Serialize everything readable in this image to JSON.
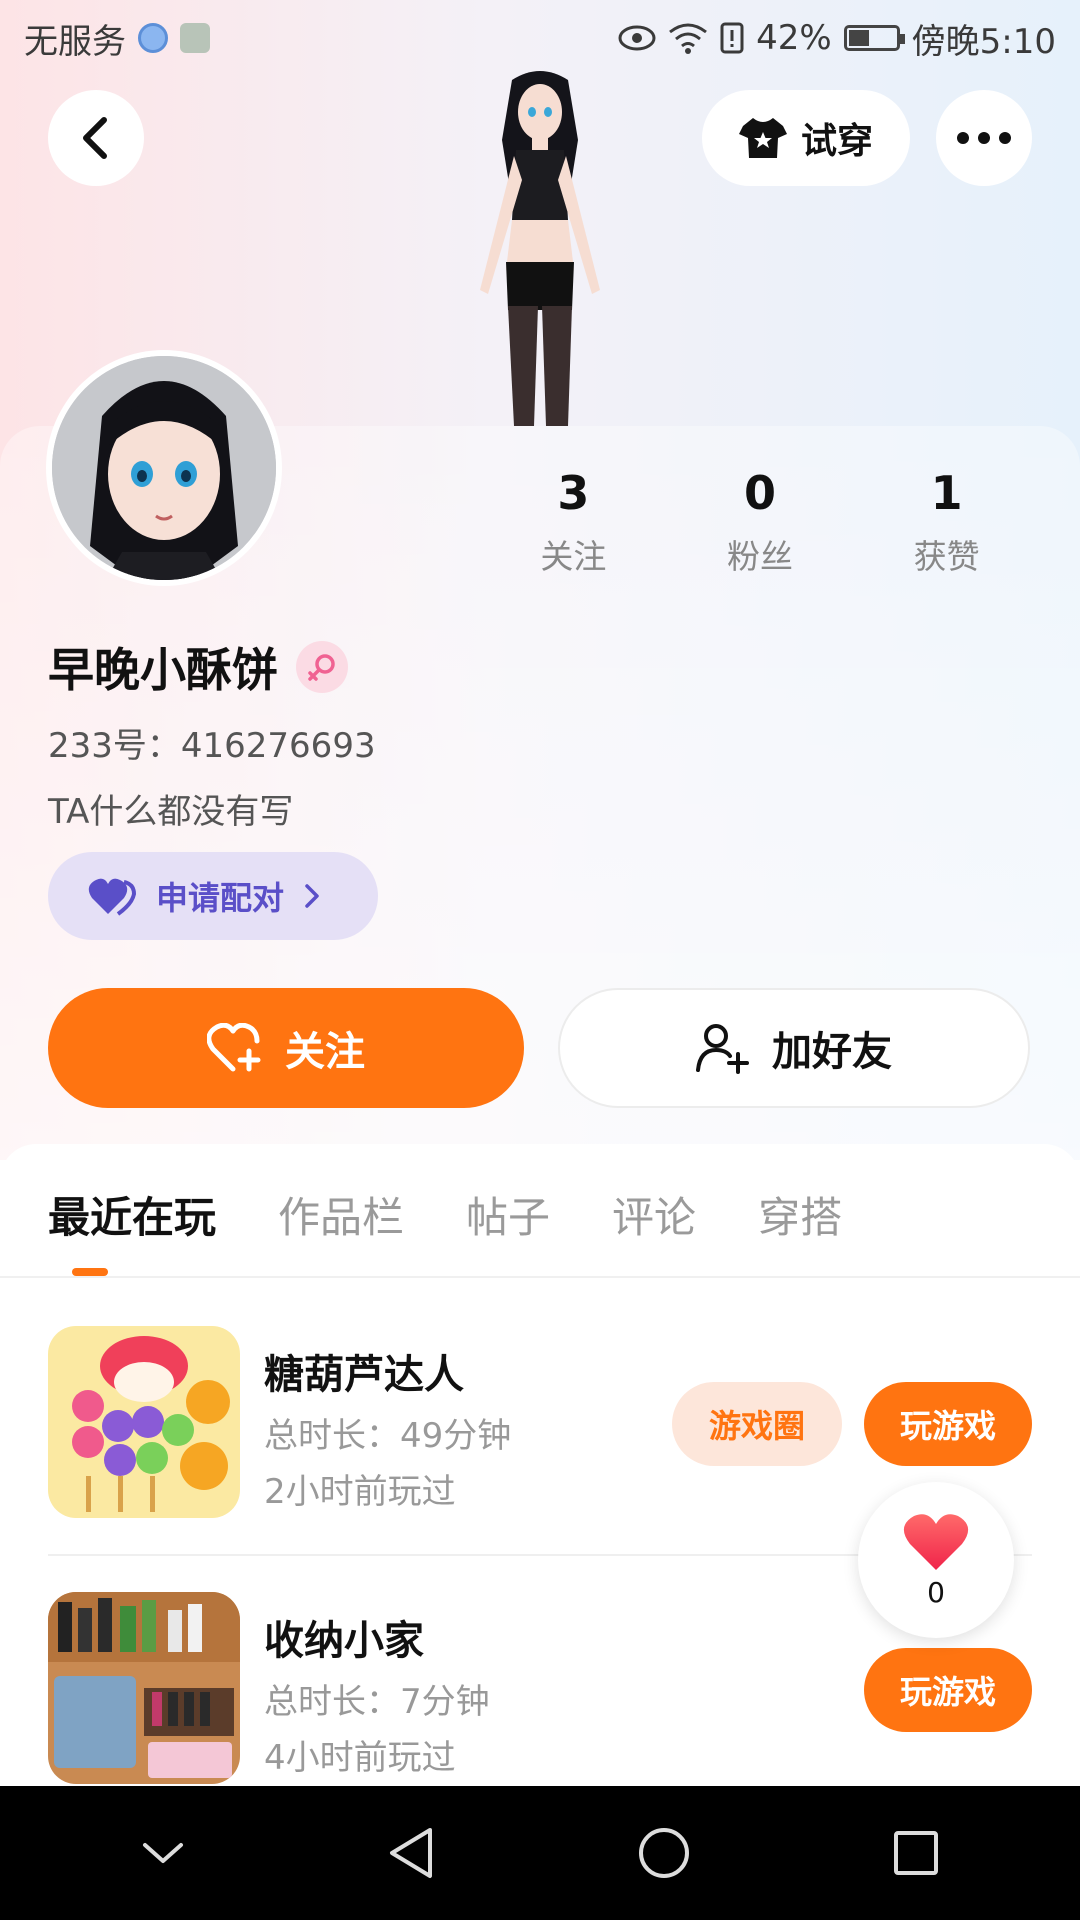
{
  "status_bar": {
    "carrier": "无服务",
    "battery_percent": "42%",
    "time": "傍晚5:10"
  },
  "header": {
    "tryon_label": "试穿"
  },
  "profile": {
    "stats": [
      {
        "value": "3",
        "label": "关注"
      },
      {
        "value": "0",
        "label": "粉丝"
      },
      {
        "value": "1",
        "label": "获赞"
      }
    ],
    "username": "早晚小酥饼",
    "id_text": "233号：416276693",
    "bio": "TA什么都没有写",
    "pair_label": "申请配对"
  },
  "actions": {
    "follow_label": "关注",
    "add_friend_label": "加好友"
  },
  "tabs": [
    {
      "label": "最近在玩",
      "active": true
    },
    {
      "label": "作品栏",
      "active": false
    },
    {
      "label": "帖子",
      "active": false
    },
    {
      "label": "评论",
      "active": false
    },
    {
      "label": "穿搭",
      "active": false
    }
  ],
  "games": [
    {
      "title": "糖葫芦达人",
      "duration": "总时长：49分钟",
      "last_played": "2小时前玩过",
      "circle_label": "游戏圈",
      "play_label": "玩游戏"
    },
    {
      "title": "收纳小家",
      "duration": "总时长：7分钟",
      "last_played": "4小时前玩过",
      "play_label": "玩游戏"
    }
  ],
  "like_float": {
    "count": "0"
  },
  "colors": {
    "accent": "#ff7411",
    "pair_bg": "#e5e0f6",
    "pair_text": "#5a4fc8"
  }
}
